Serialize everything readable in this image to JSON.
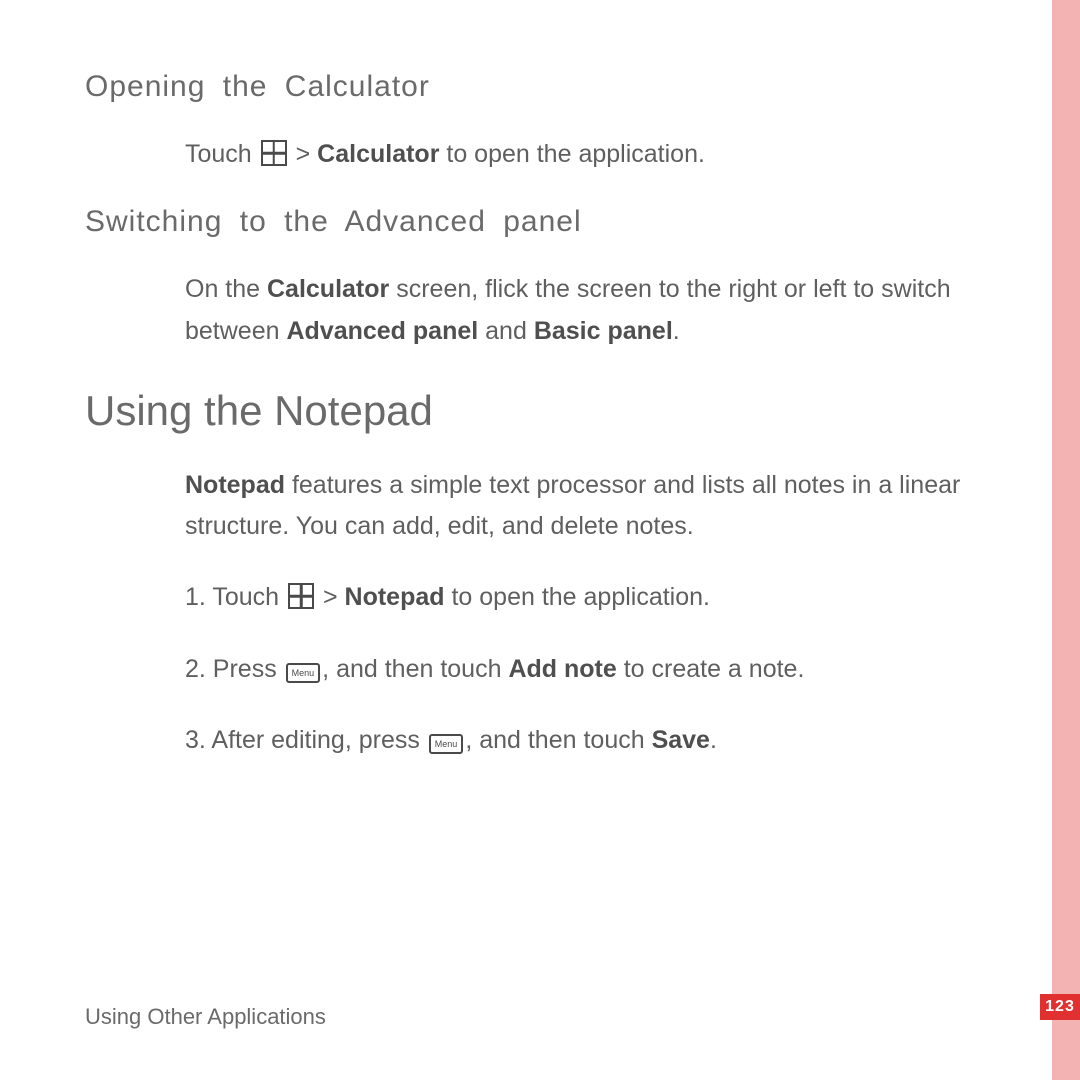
{
  "section1": {
    "heading": "Opening the Calculator",
    "p1_a": "Touch ",
    "p1_b": " > ",
    "p1_bold": "Calculator",
    "p1_c": " to open the application."
  },
  "section2": {
    "heading": "Switching to the Advanced panel",
    "p1_a": "On the ",
    "p1_b1": "Calculator",
    "p1_c": " screen, flick the screen to the right or left to switch between ",
    "p1_b2": "Advanced panel",
    "p1_d": " and ",
    "p1_b3": "Basic panel",
    "p1_e": "."
  },
  "section3": {
    "heading": "Using the Notepad",
    "intro_a": "Notepad",
    "intro_b": " features a simple text processor and lists all notes in a linear structure. You can add, edit, and delete notes.",
    "step1_a": "1. Touch ",
    "step1_b": " > ",
    "step1_bold": "Notepad",
    "step1_c": " to open the application.",
    "step2_a": "2. Press ",
    "step2_b": ", and then touch ",
    "step2_bold": "Add note",
    "step2_c": " to create a note.",
    "step3_a": "3. After editing, press ",
    "step3_b": ", and then touch ",
    "step3_bold": "Save",
    "step3_c": "."
  },
  "footer": "Using Other Applications",
  "page_number": "123",
  "menu_label": "Menu"
}
